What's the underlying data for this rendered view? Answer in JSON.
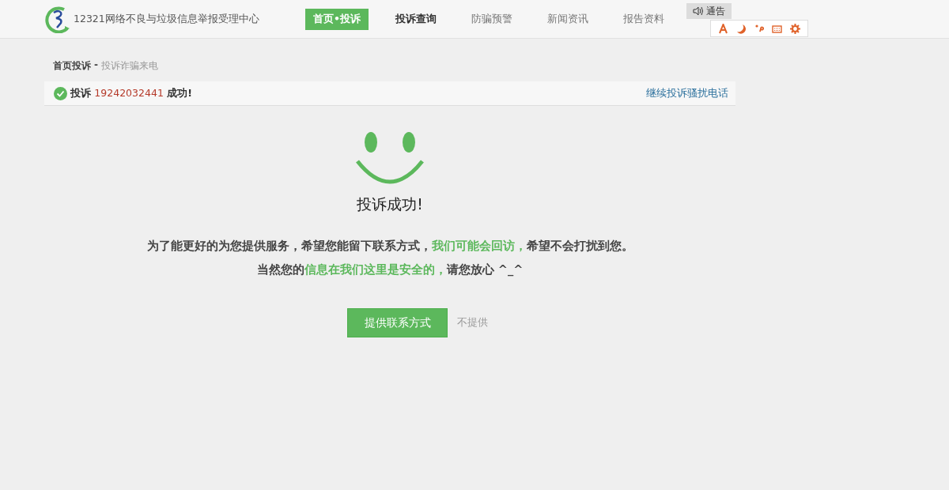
{
  "header": {
    "site_title": "12321网络不良与垃圾信息举报受理中心",
    "nav": [
      {
        "label": "首页•投诉",
        "selected": true,
        "bold": true
      },
      {
        "label": "投诉查询",
        "selected": false,
        "bold": true
      },
      {
        "label": "防骗预警",
        "selected": false,
        "bold": false
      },
      {
        "label": "新闻资讯",
        "selected": false,
        "bold": false
      },
      {
        "label": "报告资料",
        "selected": false,
        "bold": false
      }
    ],
    "notice": {
      "label": "通告"
    }
  },
  "breadcrumb": {
    "home": "首页投诉",
    "separator": "-",
    "current": "投诉诈骗来电"
  },
  "status_bar": {
    "prefix": "投诉",
    "number": "19242032441",
    "suffix": "成功!",
    "link": "继续投诉骚扰电话"
  },
  "result": {
    "title": "投诉成功!",
    "paragraphs": [
      [
        {
          "text": "为了能更好的为您提供服务，希望您能留下联系方式，",
          "highlight": false
        },
        {
          "text": "我们可能会回访，",
          "highlight": true
        },
        {
          "text": "希望不会打扰到您。",
          "highlight": false
        }
      ],
      [
        {
          "text": "当然您的",
          "highlight": false
        },
        {
          "text": "信息在我们这里是安全的，",
          "highlight": true
        },
        {
          "text": "请您放心 ^_^",
          "highlight": false
        }
      ]
    ],
    "primary_button": "提供联系方式",
    "secondary_link": "不提供"
  }
}
